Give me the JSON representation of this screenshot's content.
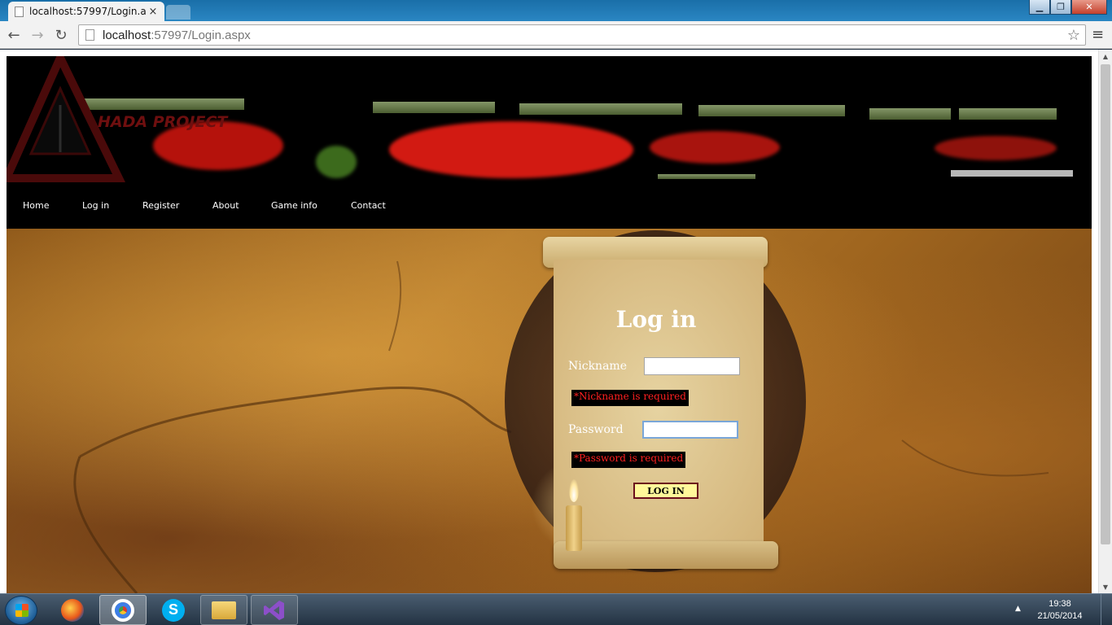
{
  "browser": {
    "tab_title": "localhost:57997/Login.asp",
    "tab_close": "×",
    "url_host": "localhost",
    "url_path": ":57997/Login.aspx",
    "window_buttons": {
      "minimize": "▁",
      "maximize": "❐",
      "close": "✕"
    },
    "nav": {
      "back": "←",
      "forward": "→",
      "reload": "↻",
      "star": "☆",
      "menu": "≡"
    }
  },
  "site": {
    "logo_text": "HADA PROJECT",
    "nav": [
      "Home",
      "Log in",
      "Register",
      "About",
      "Game info",
      "Contact"
    ]
  },
  "login": {
    "title": "Log in",
    "nickname_label": "Nickname",
    "nickname_value": "",
    "nickname_error": "*Nickname is required",
    "password_label": "Password",
    "password_value": "",
    "password_error": "*Password is required",
    "button": "LOG IN"
  },
  "taskbar": {
    "time": "19:38",
    "date": "21/05/2014",
    "tray_arrow": "▲"
  }
}
